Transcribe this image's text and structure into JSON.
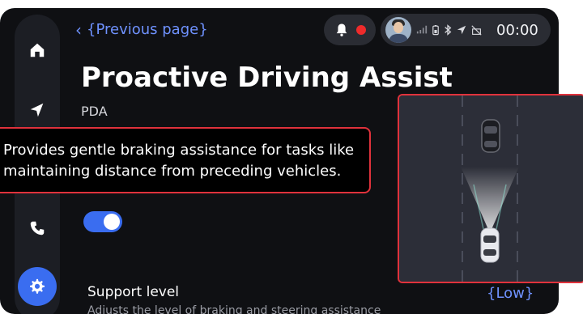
{
  "nav": {
    "back_label": "{Previous page}"
  },
  "header": {
    "time": "00:00"
  },
  "page": {
    "title": "Proactive Driving Assist",
    "subtitle": "PDA",
    "description": "Provides gentle braking assistance for tasks like maintaining distance from preceding vehicles.",
    "toggle_on": true
  },
  "support": {
    "label": "Support level",
    "description": "Adjusts the level of braking and steering assistance",
    "value": "{Low}"
  },
  "sidebar": {
    "items": [
      {
        "icon": "home-icon"
      },
      {
        "icon": "navigation-icon"
      },
      {
        "icon": "phone-icon"
      },
      {
        "icon": "settings-icon",
        "active": true
      }
    ]
  },
  "colors": {
    "accent": "#3a6df0",
    "link": "#6f92ff",
    "highlight": "#e0323c",
    "background": "#0f1013"
  }
}
